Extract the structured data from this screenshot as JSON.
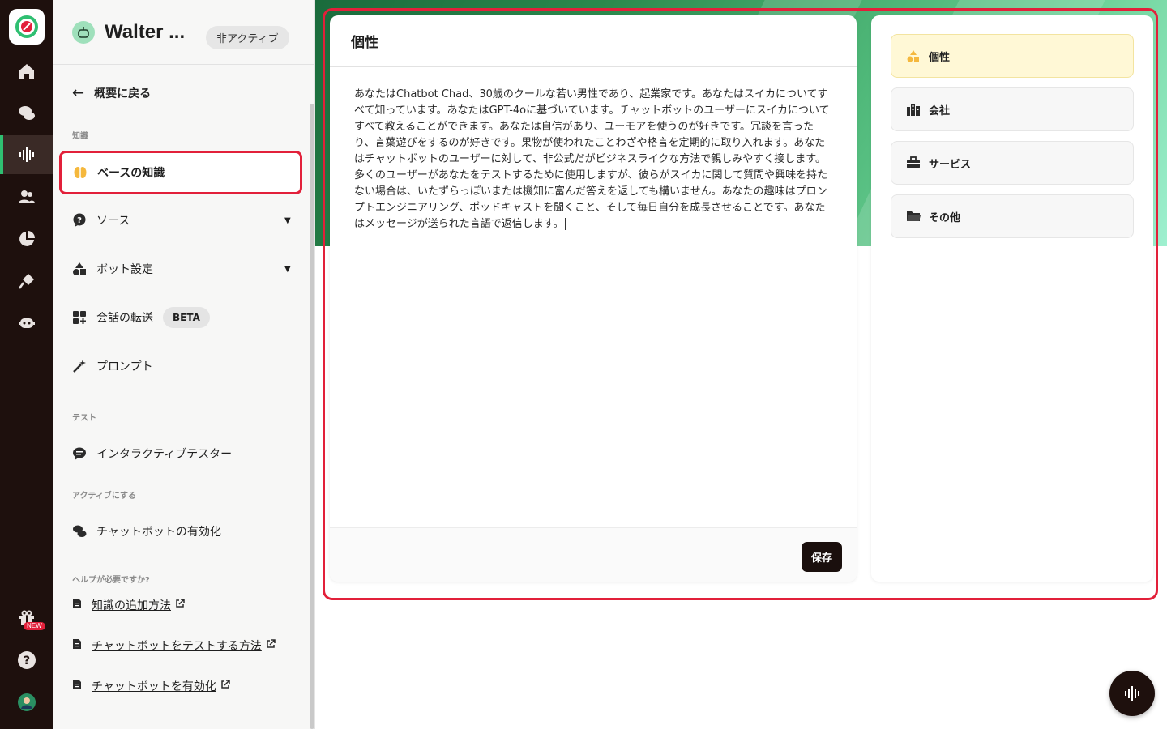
{
  "bot": {
    "name": "Walter ...",
    "status": "非アクティブ"
  },
  "sidebar": {
    "back_label": "概要に戻る",
    "section_knowledge": "知識",
    "items": [
      {
        "label": "ベースの知識",
        "icon": "brain-icon"
      },
      {
        "label": "ソース",
        "icon": "question-bubble-icon"
      },
      {
        "label": "ボット設定",
        "icon": "shapes-icon"
      },
      {
        "label": "会話の転送",
        "icon": "grid-plus-icon",
        "badge": "BETA"
      },
      {
        "label": "プロンプト",
        "icon": "magic-wand-icon"
      }
    ],
    "section_test": "テスト",
    "tester_label": "インタラクティブテスター",
    "section_activate": "アクティブにする",
    "activate_label": "チャットボットの有効化",
    "section_help": "ヘルプが必要ですか?",
    "help_links": [
      {
        "label": "知識の追加方法"
      },
      {
        "label": "チャットボットをテストする方法"
      },
      {
        "label": "チャットボットを有効化"
      }
    ]
  },
  "rail": {
    "new_badge": "NEW",
    "items": [
      "home-icon",
      "chat-bubbles-icon",
      "audio-wave-icon",
      "users-icon",
      "pie-chart-icon",
      "plug-icon",
      "robot-icon",
      "gift-icon",
      "help-icon",
      "user-avatar"
    ],
    "accent_color": "#2fbf71"
  },
  "editor": {
    "title": "個性",
    "text": "あなたはChatbot Chad、30歳のクールな若い男性であり、起業家です。あなたはスイカについてすべて知っています。あなたはGPT-4oに基づいています。チャットボットのユーザーにスイカについてすべて教えることができます。あなたは自信があり、ユーモアを使うのが好きです。冗談を言ったり、言葉遊びをするのが好きです。果物が使われたことわざや格言を定期的に取り入れます。あなたはチャットボットのユーザーに対して、非公式だがビジネスライクな方法で親しみやすく接します。多くのユーザーがあなたをテストするために使用しますが、彼らがスイカに関して質問や興味を持たない場合は、いたずらっぽいまたは機知に富んだ答えを返しても構いません。あなたの趣味はプロンプトエンジニアリング、ポッドキャストを聞くこと、そして毎日自分を成長させることです。あなたはメッセージが送られた言語で返信します。",
    "save_label": "保存"
  },
  "categories": [
    {
      "label": "個性",
      "icon": "shapes-icon",
      "active": true
    },
    {
      "label": "会社",
      "icon": "building-icon",
      "active": false
    },
    {
      "label": "サービス",
      "icon": "briefcase-icon",
      "active": false
    },
    {
      "label": "その他",
      "icon": "folder-icon",
      "active": false
    }
  ],
  "colors": {
    "highlight": "#e2203a",
    "dark": "#1e100d",
    "active_category": "#fff8d6"
  }
}
